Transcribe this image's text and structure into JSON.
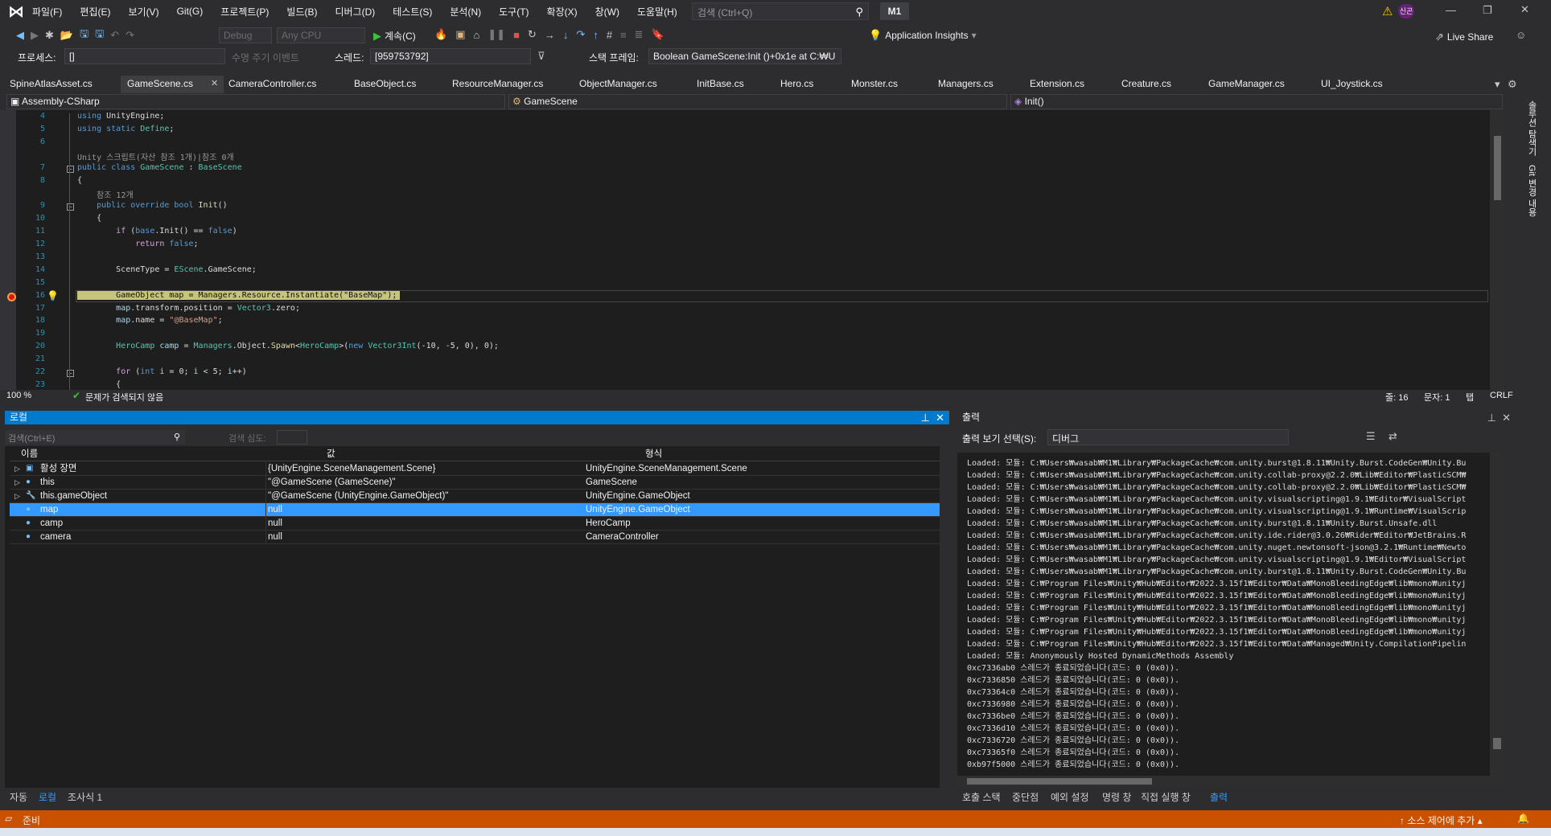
{
  "titlebar": {
    "menus": [
      "파일(F)",
      "편집(E)",
      "보기(V)",
      "Git(G)",
      "프로젝트(P)",
      "빌드(B)",
      "디버그(D)",
      "테스트(S)",
      "분석(N)",
      "도구(T)",
      "확장(X)",
      "창(W)",
      "도움말(H)"
    ],
    "search_placeholder": "검색 (Ctrl+Q)",
    "solution": "M1",
    "user_initials": "신곤"
  },
  "toolbar": {
    "config": "Debug",
    "platform": "Any CPU",
    "continue": "계속(C)",
    "app_insights": "Application Insights",
    "live_share": "Live Share",
    "process_label": "프로세스:",
    "process_value": "[]",
    "lifecycle": "수명 주기 이벤트",
    "thread_label": "스레드:",
    "thread_value": "[959753792]",
    "stackframe_label": "스택 프레임:",
    "stackframe_value": "Boolean GameScene:Init ()+0x1e at C:₩U"
  },
  "tabs": [
    "SpineAtlasAsset.cs",
    "GameScene.cs",
    "CameraController.cs",
    "BaseObject.cs",
    "ResourceManager.cs",
    "ObjectManager.cs",
    "InitBase.cs",
    "Hero.cs",
    "Monster.cs",
    "Managers.cs",
    "Extension.cs",
    "Creature.cs",
    "GameManager.cs",
    "UI_Joystick.cs"
  ],
  "active_tab": "GameScene.cs",
  "nav": {
    "project": "Assembly-CSharp",
    "class": "GameScene",
    "member": "Init()"
  },
  "side_tabs": [
    "솔루션 탐색기",
    "Git 변경 내용"
  ],
  "code": {
    "lens1": "Unity 스크립트(자산 참조 1개)|참조 0개",
    "lens2": "참조 12개",
    "lines": [
      {
        "n": "4",
        "t": [
          [
            "using",
            "kw"
          ],
          [
            " UnityEngine;",
            "pl"
          ]
        ]
      },
      {
        "n": "5",
        "t": [
          [
            "using static",
            "kw"
          ],
          [
            " ",
            "pl"
          ],
          [
            "Define",
            "ty"
          ],
          [
            ";",
            "pl"
          ]
        ]
      },
      {
        "n": "6",
        "t": []
      },
      {
        "n": "7",
        "t": [
          [
            "public class",
            "kw"
          ],
          [
            " ",
            "pl"
          ],
          [
            "GameScene",
            "ty"
          ],
          [
            " : ",
            "pl"
          ],
          [
            "BaseScene",
            "ty"
          ]
        ]
      },
      {
        "n": "8",
        "t": [
          [
            "{",
            "pl"
          ]
        ]
      },
      {
        "n": "9",
        "t": [
          [
            "    public override bool",
            "kw"
          ],
          [
            " ",
            "pl"
          ],
          [
            "Init",
            "fn"
          ],
          [
            "()",
            "pl"
          ]
        ]
      },
      {
        "n": "10",
        "t": [
          [
            "    {",
            "pl"
          ]
        ]
      },
      {
        "n": "11",
        "t": [
          [
            "        ",
            "pl"
          ],
          [
            "if",
            "ct"
          ],
          [
            " (",
            "pl"
          ],
          [
            "base",
            "kw"
          ],
          [
            ".Init() == ",
            "pl"
          ],
          [
            "false",
            "kw"
          ],
          [
            ")",
            "pl"
          ]
        ]
      },
      {
        "n": "12",
        "t": [
          [
            "            ",
            "pl"
          ],
          [
            "return",
            "ct"
          ],
          [
            " ",
            "pl"
          ],
          [
            "false",
            "kw"
          ],
          [
            ";",
            "pl"
          ]
        ]
      },
      {
        "n": "13",
        "t": []
      },
      {
        "n": "14",
        "t": [
          [
            "        SceneType = ",
            "pl"
          ],
          [
            "EScene",
            "ty"
          ],
          [
            ".GameScene;",
            "pl"
          ]
        ]
      },
      {
        "n": "15",
        "t": []
      },
      {
        "n": "16",
        "t": [
          [
            "        GameObject map = Managers.Resource.Instantiate(\"BaseMap\");",
            "pl"
          ]
        ]
      },
      {
        "n": "17",
        "t": [
          [
            "        ",
            "pl"
          ],
          [
            "map",
            "va"
          ],
          [
            ".transform.position = ",
            "pl"
          ],
          [
            "Vector3",
            "ty"
          ],
          [
            ".zero;",
            "pl"
          ]
        ]
      },
      {
        "n": "18",
        "t": [
          [
            "        ",
            "pl"
          ],
          [
            "map",
            "va"
          ],
          [
            ".name = ",
            "pl"
          ],
          [
            "\"@BaseMap\"",
            "st"
          ],
          [
            ";",
            "pl"
          ]
        ]
      },
      {
        "n": "19",
        "t": []
      },
      {
        "n": "20",
        "t": [
          [
            "        ",
            "pl"
          ],
          [
            "HeroCamp",
            "ty"
          ],
          [
            " ",
            "pl"
          ],
          [
            "camp",
            "va"
          ],
          [
            " = ",
            "pl"
          ],
          [
            "Managers",
            "ty"
          ],
          [
            ".Object.",
            "pl"
          ],
          [
            "Spawn",
            "fn"
          ],
          [
            "<",
            "pl"
          ],
          [
            "HeroCamp",
            "ty"
          ],
          [
            ">(",
            "pl"
          ],
          [
            "new",
            "kw"
          ],
          [
            " ",
            "pl"
          ],
          [
            "Vector3Int",
            "ty"
          ],
          [
            "(-10, -5, 0), 0);",
            "pl"
          ]
        ]
      },
      {
        "n": "21",
        "t": []
      },
      {
        "n": "22",
        "t": [
          [
            "        ",
            "pl"
          ],
          [
            "for",
            "ct"
          ],
          [
            " (",
            "pl"
          ],
          [
            "int",
            "kw"
          ],
          [
            " ",
            "pl"
          ],
          [
            "i",
            "va"
          ],
          [
            " = 0; ",
            "pl"
          ],
          [
            "i",
            "va"
          ],
          [
            " < 5; ",
            "pl"
          ],
          [
            "i",
            "va"
          ],
          [
            "++)",
            "pl"
          ]
        ]
      },
      {
        "n": "23",
        "t": [
          [
            "        {",
            "pl"
          ]
        ]
      }
    ]
  },
  "editor_status": {
    "zoom": "100 %",
    "issues": "문제가 검색되지 않음",
    "line": "줄: 16",
    "col": "문자: 1",
    "indent": "탭",
    "eol": "CRLF"
  },
  "locals": {
    "title": "로컬",
    "search_placeholder": "검색(Ctrl+E)",
    "search_depth": "검색 심도:",
    "columns": [
      "이름",
      "값",
      "형식"
    ],
    "rows": [
      {
        "name": "활성 장면",
        "value": "{UnityEngine.SceneManagement.Scene}",
        "type": "UnityEngine.SceneManagement.Scene",
        "expand": true
      },
      {
        "name": "this",
        "value": "\"@GameScene (GameScene)\"",
        "type": "GameScene",
        "expand": true
      },
      {
        "name": "this.gameObject",
        "value": "\"@GameScene (UnityEngine.GameObject)\"",
        "type": "UnityEngine.GameObject",
        "expand": true
      },
      {
        "name": "map",
        "value": "null",
        "type": "UnityEngine.GameObject",
        "selected": true
      },
      {
        "name": "camp",
        "value": "null",
        "type": "HeroCamp"
      },
      {
        "name": "camera",
        "value": "null",
        "type": "CameraController"
      }
    ],
    "bottom_tabs": [
      "자동",
      "로컬",
      "조사식 1"
    ],
    "active_bottom_tab": "로컬"
  },
  "output": {
    "title": "출력",
    "show_label": "출력 보기 선택(S):",
    "show_value": "디버그",
    "lines": [
      "Loaded: 모듈: C:₩Users₩wasab₩M1₩Library₩PackageCache₩com.unity.burst@1.8.11₩Unity.Burst.CodeGen₩Unity.Bu",
      "Loaded: 모듈: C:₩Users₩wasab₩M1₩Library₩PackageCache₩com.unity.collab-proxy@2.2.0₩Lib₩Editor₩PlasticSCM₩",
      "Loaded: 모듈: C:₩Users₩wasab₩M1₩Library₩PackageCache₩com.unity.collab-proxy@2.2.0₩Lib₩Editor₩PlasticSCM₩",
      "Loaded: 모듈: C:₩Users₩wasab₩M1₩Library₩PackageCache₩com.unity.visualscripting@1.9.1₩Editor₩VisualScript",
      "Loaded: 모듈: C:₩Users₩wasab₩M1₩Library₩PackageCache₩com.unity.visualscripting@1.9.1₩Runtime₩VisualScrip",
      "Loaded: 모듈: C:₩Users₩wasab₩M1₩Library₩PackageCache₩com.unity.burst@1.8.11₩Unity.Burst.Unsafe.dll",
      "Loaded: 모듈: C:₩Users₩wasab₩M1₩Library₩PackageCache₩com.unity.ide.rider@3.0.26₩Rider₩Editor₩JetBrains.R",
      "Loaded: 모듈: C:₩Users₩wasab₩M1₩Library₩PackageCache₩com.unity.nuget.newtonsoft-json@3.2.1₩Runtime₩Newto",
      "Loaded: 모듈: C:₩Users₩wasab₩M1₩Library₩PackageCache₩com.unity.visualscripting@1.9.1₩Editor₩VisualScript",
      "Loaded: 모듈: C:₩Users₩wasab₩M1₩Library₩PackageCache₩com.unity.burst@1.8.11₩Unity.Burst.CodeGen₩Unity.Bu",
      "Loaded: 모듈: C:₩Program Files₩Unity₩Hub₩Editor₩2022.3.15f1₩Editor₩Data₩MonoBleedingEdge₩lib₩mono₩unityj",
      "Loaded: 모듈: C:₩Program Files₩Unity₩Hub₩Editor₩2022.3.15f1₩Editor₩Data₩MonoBleedingEdge₩lib₩mono₩unityj",
      "Loaded: 모듈: C:₩Program Files₩Unity₩Hub₩Editor₩2022.3.15f1₩Editor₩Data₩MonoBleedingEdge₩lib₩mono₩unityj",
      "Loaded: 모듈: C:₩Program Files₩Unity₩Hub₩Editor₩2022.3.15f1₩Editor₩Data₩MonoBleedingEdge₩lib₩mono₩unityj",
      "Loaded: 모듈: C:₩Program Files₩Unity₩Hub₩Editor₩2022.3.15f1₩Editor₩Data₩MonoBleedingEdge₩lib₩mono₩unityj",
      "Loaded: 모듈: C:₩Program Files₩Unity₩Hub₩Editor₩2022.3.15f1₩Editor₩Data₩Managed₩Unity.CompilationPipelin",
      "Loaded: 모듈: Anonymously Hosted DynamicMethods Assembly",
      "0xc7336ab0 스레드가 종료되었습니다(코드: 0 (0x0)).",
      "0xc7336850 스레드가 종료되었습니다(코드: 0 (0x0)).",
      "0xc73364c0 스레드가 종료되었습니다(코드: 0 (0x0)).",
      "0xc7336980 스레드가 종료되었습니다(코드: 0 (0x0)).",
      "0xc7336be0 스레드가 종료되었습니다(코드: 0 (0x0)).",
      "0xc7336d10 스레드가 종료되었습니다(코드: 0 (0x0)).",
      "0xc7336720 스레드가 종료되었습니다(코드: 0 (0x0)).",
      "0xc73365f0 스레드가 종료되었습니다(코드: 0 (0x0)).",
      "0xb97f5000 스레드가 종료되었습니다(코드: 0 (0x0))."
    ],
    "bottom_tabs": [
      "호출 스택",
      "중단점",
      "예외 설정",
      "명령 창",
      "직접 실행 창",
      "출력"
    ],
    "active_bottom_tab": "출력"
  },
  "statusbar": {
    "ready": "준비",
    "source_control": "소스 제어에 추가",
    "color": "#ca5100"
  },
  "colors": {
    "accent": "#007acc",
    "selection": "#3399ff",
    "breakpoint": "#e51400"
  }
}
